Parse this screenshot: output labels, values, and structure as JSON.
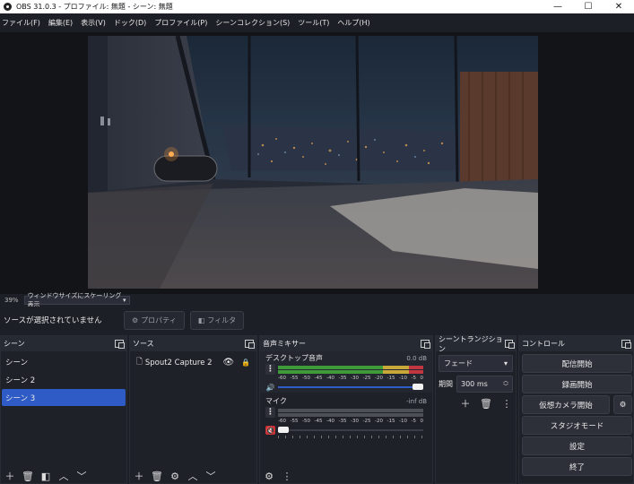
{
  "app": {
    "title": "OBS 31.0.3 - プロファイル: 無題 - シーン: 無題"
  },
  "window_controls": {
    "minimize": "—",
    "maximize": "☐",
    "close": "✕"
  },
  "menu": [
    "ファイル(F)",
    "編集(E)",
    "表示(V)",
    "ドック(D)",
    "プロファイル(P)",
    "シーンコレクション(S)",
    "ツール(T)",
    "ヘルプ(H)"
  ],
  "status": {
    "zoom": "39%",
    "scale_mode": "ウィンドウサイズにスケーリング表示"
  },
  "source_toolbar": {
    "no_source": "ソースが選択されていません",
    "properties": "プロパティ",
    "filters": "フィルタ"
  },
  "scenes": {
    "title": "シーン",
    "items": [
      "シーン",
      "シーン 2",
      "シーン 3"
    ],
    "selected": 2
  },
  "sources": {
    "title": "ソース",
    "items": [
      {
        "name": "Spout2 Capture 2",
        "visible": true,
        "locked": true
      }
    ]
  },
  "mixer": {
    "title": "音声ミキサー",
    "channels": [
      {
        "name": "デスクトップ音声",
        "db": "0.0 dB",
        "volume": 1.0,
        "muted": false,
        "peak": 1.0
      },
      {
        "name": "マイク",
        "db": "-inf dB",
        "volume": 0.0,
        "muted": true,
        "peak": 0.0
      }
    ],
    "scale": [
      "-60",
      "-55",
      "-50",
      "-45",
      "-40",
      "-35",
      "-30",
      "-25",
      "-20",
      "-15",
      "-10",
      "-5",
      "0"
    ]
  },
  "transitions": {
    "title": "シーントランジション",
    "selected": "フェード",
    "duration_label": "期間",
    "duration": "300 ms"
  },
  "controls": {
    "title": "コントロール",
    "buttons": [
      "配信開始",
      "録画開始",
      "仮想カメラ開始",
      "スタジオモード",
      "設定",
      "終了"
    ]
  },
  "colors": {
    "accent": "#2f5bc6",
    "meter_green": "#3f9a3a",
    "meter_yellow": "#c9a83a",
    "meter_red": "#c0353f",
    "muted_red": "#c9323b"
  }
}
